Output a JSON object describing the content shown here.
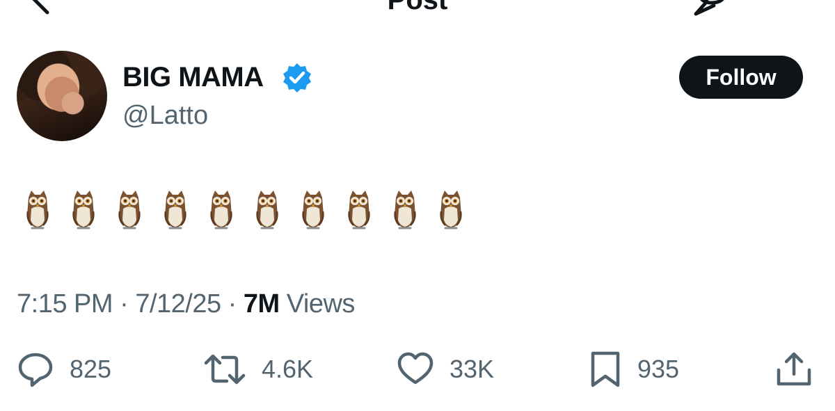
{
  "header": {
    "title": "Post",
    "back_icon": "back-arrow-icon",
    "reply_icon": "reply-icon",
    "more_icon": "more-icon"
  },
  "author": {
    "display_name": "BIG MAMA",
    "handle": "@Latto",
    "verified": true,
    "verified_color": "#1d9bf0"
  },
  "follow_button": {
    "label": "Follow"
  },
  "tweet": {
    "text": "🦉🦉🦉🦉🦉🦉🦉🦉🦉🦉",
    "emoji_name": "owl-icon",
    "emoji_count": 10
  },
  "meta": {
    "time": "7:15 PM",
    "separator": " · ",
    "date": "7/12/25",
    "views_count": "7M",
    "views_label": " Views"
  },
  "actions": {
    "replies": "825",
    "reposts": "4.6K",
    "likes": "33K",
    "bookmarks": "935",
    "icons": [
      "reply-icon",
      "repost-icon",
      "heart-icon",
      "bookmark-icon",
      "share-icon"
    ]
  },
  "colors": {
    "text_primary": "#0f1419",
    "text_secondary": "#536471",
    "follow_bg": "#0f1419",
    "verified_badge": "#1d9bf0"
  }
}
